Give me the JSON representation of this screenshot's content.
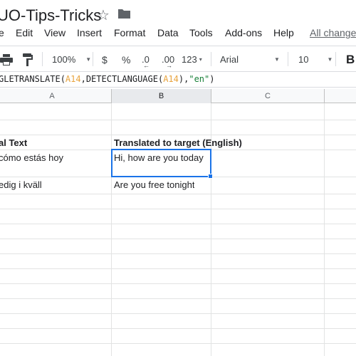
{
  "title_bar": {
    "doc_title": "UO-Tips-Tricks",
    "star_glyph": "☆"
  },
  "menu": {
    "items": [
      "e",
      "Edit",
      "View",
      "Insert",
      "Format",
      "Data",
      "Tools",
      "Add-ons",
      "Help"
    ],
    "all_changes": "All change"
  },
  "toolbar": {
    "zoom": "100%",
    "currency": "$",
    "percent": "%",
    "dec_decrease": ".0",
    "dec_increase": ".00",
    "more_formats": "123",
    "font": "Arial",
    "font_size": "10",
    "bold": "B"
  },
  "formula_bar": {
    "prefix": "GLETRANSLATE(",
    "ref1": "A14",
    "mid": ",DETECTLANGUAGE(",
    "ref2": "A14",
    "sep": "),",
    "str": "\"en\"",
    "suffix": ")"
  },
  "grid": {
    "columns": [
      "A",
      "B",
      "C"
    ],
    "active_column": "B",
    "rows": [
      {
        "a": "al Text",
        "b": "Translated to target (English)",
        "bold": true
      },
      {
        "a": "cómo estás hoy",
        "b": "Hi, how are you today",
        "bold": false
      },
      {
        "a": "edig i kväll",
        "b": "Are you free tonight",
        "bold": false
      }
    ]
  },
  "colors": {
    "selection": "#1a73e8",
    "cell_reference": "#e8a33d",
    "string_literal": "#188038"
  }
}
